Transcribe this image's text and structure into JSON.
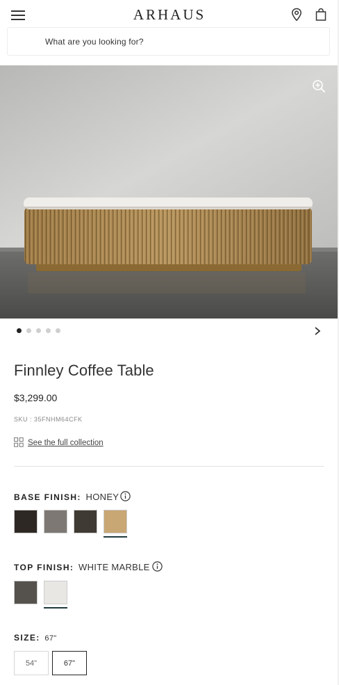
{
  "header": {
    "logo": "ARHAUS",
    "menu_icon": "hamburger-menu-icon",
    "location_icon": "map-pin-icon",
    "bag_icon": "shopping-bag-icon"
  },
  "search": {
    "placeholder": "What are you looking for?"
  },
  "gallery": {
    "zoom_icon": "zoom-in-icon",
    "image_count": 5,
    "active_index": 0,
    "next_icon": "chevron-right-icon"
  },
  "product": {
    "title": "Finnley Coffee Table",
    "price": "$3,299.00",
    "sku": "SKU : 35FNHM64CFK",
    "collection_link": "See the full collection",
    "collection_icon": "grid-icon"
  },
  "base_finish": {
    "label": "BASE FINISH:",
    "value": "HONEY",
    "info_icon": "info-icon",
    "swatches": [
      {
        "name": "dark-brown",
        "color": "#2e2824"
      },
      {
        "name": "gray-wash",
        "color": "#7d7873"
      },
      {
        "name": "smoked",
        "color": "#3f3a33"
      },
      {
        "name": "honey",
        "color": "#c8a774",
        "selected": true
      }
    ]
  },
  "top_finish": {
    "label": "TOP FINISH:",
    "value": "WHITE MARBLE",
    "info_icon": "info-icon",
    "swatches": [
      {
        "name": "dark-stone",
        "color": "#55524d"
      },
      {
        "name": "white-marble",
        "color": "#e9e7e4",
        "selected": true
      }
    ]
  },
  "size": {
    "label": "SIZE:",
    "value": "67\"",
    "options": [
      "54\"",
      "67\""
    ],
    "selected_index": 1
  },
  "colors": {
    "accent_underline": "#1f3a3f",
    "text_primary": "#222222"
  }
}
